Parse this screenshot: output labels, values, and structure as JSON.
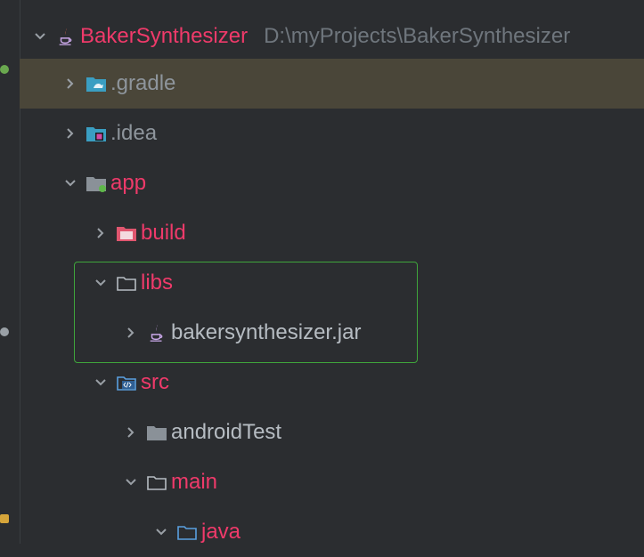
{
  "colors": {
    "background": "#2b2d30",
    "selected_row": "#4a4639",
    "label_red": "#ef3a6a",
    "label_gray": "#8e959c",
    "path_gray": "#6f767d",
    "highlight_border": "#3fa53b"
  },
  "project_tree": {
    "root": {
      "name": "BakerSynthesizer",
      "path": "D:\\myProjects\\BakerSynthesizer",
      "icon": "java-project-icon"
    },
    "items": [
      {
        "label": ".gradle",
        "icon": "gradle-folder-icon",
        "expanded": false,
        "selected": true
      },
      {
        "label": ".idea",
        "icon": "idea-folder-icon",
        "expanded": false
      },
      {
        "label": "app",
        "icon": "module-folder-icon",
        "expanded": true
      },
      {
        "label": "build",
        "icon": "build-folder-icon",
        "expanded": false
      },
      {
        "label": "libs",
        "icon": "folder-icon",
        "expanded": true
      },
      {
        "label": "bakersynthesizer.jar",
        "icon": "jar-icon",
        "expanded": false
      },
      {
        "label": "src",
        "icon": "source-folder-icon",
        "expanded": true
      },
      {
        "label": "androidTest",
        "icon": "folder-icon",
        "expanded": false
      },
      {
        "label": "main",
        "icon": "folder-icon",
        "expanded": true
      },
      {
        "label": "java",
        "icon": "folder-icon",
        "expanded": true
      }
    ]
  }
}
